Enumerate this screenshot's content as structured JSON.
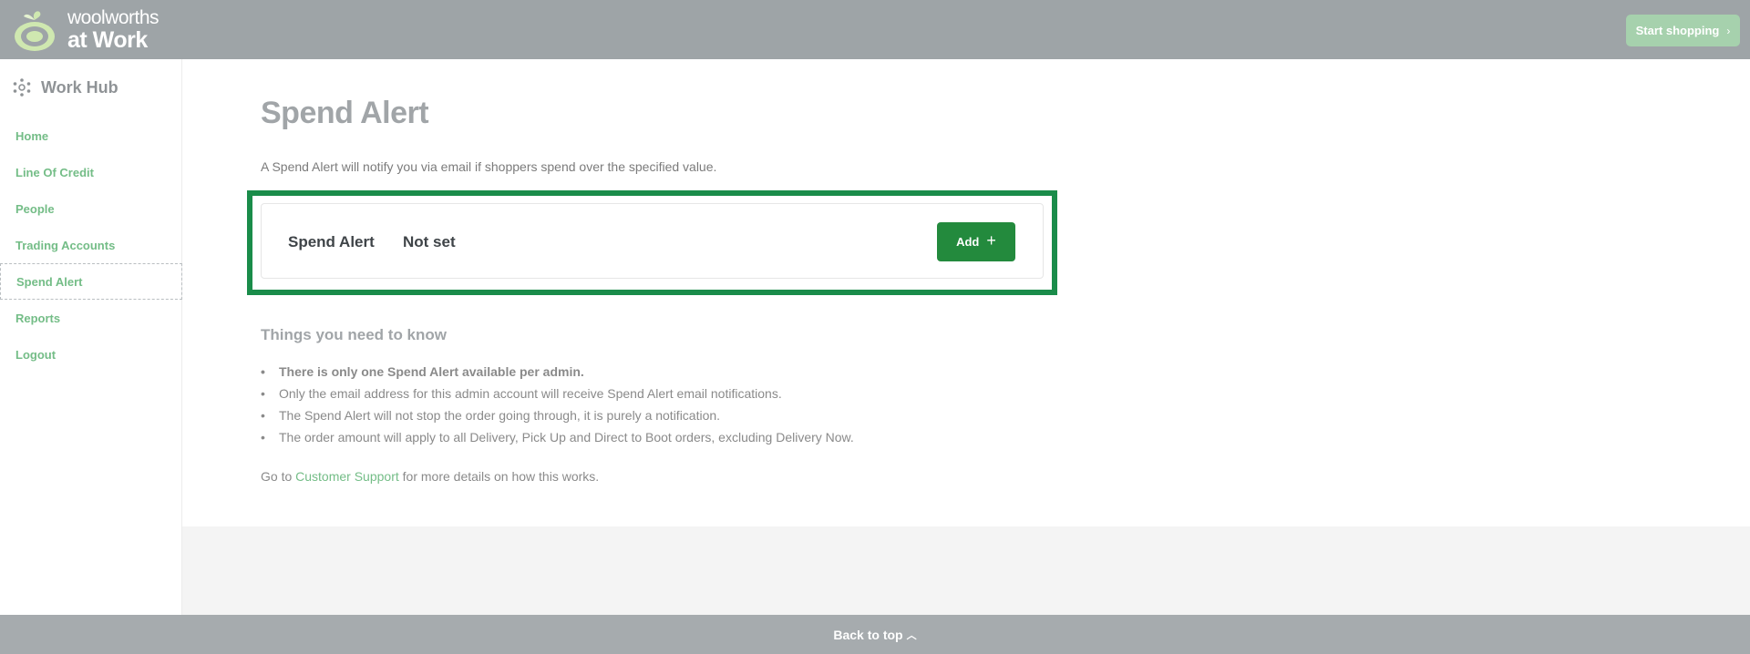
{
  "header": {
    "logo_line1": "woolworths",
    "logo_line2": "at Work",
    "start_shopping": "Start shopping",
    "start_chevron": "›"
  },
  "sidebar": {
    "title": "Work Hub",
    "items": [
      {
        "label": "Home"
      },
      {
        "label": "Line Of Credit"
      },
      {
        "label": "People"
      },
      {
        "label": "Trading Accounts"
      },
      {
        "label": "Spend Alert"
      },
      {
        "label": "Reports"
      },
      {
        "label": "Logout"
      }
    ]
  },
  "main": {
    "title": "Spend Alert",
    "intro": "A Spend Alert will notify you via email if shoppers spend over the specified value.",
    "card": {
      "label": "Spend Alert",
      "value": "Not set",
      "add_label": "Add",
      "add_icon": "+"
    },
    "know_title": "Things you need to know",
    "know_items": [
      "There is only one Spend Alert available per admin.",
      "Only the email address for this admin account will receive Spend Alert email notifications.",
      "The Spend Alert will not stop the order going through, it is purely a notification.",
      "The order amount will apply to all Delivery, Pick Up and Direct to Boot orders, excluding Delivery Now."
    ],
    "goto_prefix": "Go to ",
    "goto_link": "Customer Support",
    "goto_suffix": " for more details on how this works."
  },
  "footer": {
    "back_to_top": "Back to top",
    "caret": "︿"
  },
  "colors": {
    "topbar": "#9ea4a7",
    "accent_green": "#238a3d",
    "highlight_border": "#1a8c4a",
    "nav_green": "#74bd87"
  }
}
